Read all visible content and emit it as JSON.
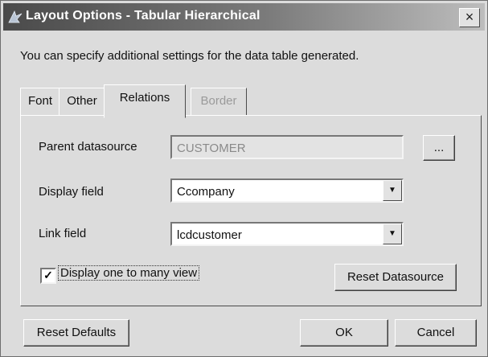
{
  "dialog": {
    "title": "Layout Options - Tabular Hierarchical",
    "close_glyph": "×",
    "description": "You can specify additional settings for the data table generated."
  },
  "tabs": [
    {
      "label": "Font",
      "active": false,
      "disabled": false
    },
    {
      "label": "Other",
      "active": false,
      "disabled": false
    },
    {
      "label": "Relations",
      "active": true,
      "disabled": false
    },
    {
      "label": "Border",
      "active": false,
      "disabled": true
    }
  ],
  "relations": {
    "parent_datasource": {
      "label": "Parent datasource",
      "value": "CUSTOMER",
      "browse_label": "..."
    },
    "display_field": {
      "label": "Display field",
      "value": "Ccompany"
    },
    "link_field": {
      "label": "Link field",
      "value": "lcdcustomer"
    },
    "one_to_many": {
      "label": "Display one to many view",
      "checked": true,
      "check_glyph": "✓"
    },
    "reset_datasource_label": "Reset Datasource"
  },
  "footer": {
    "reset_defaults_label": "Reset Defaults",
    "ok_label": "OK",
    "cancel_label": "Cancel"
  },
  "icons": {
    "title_logo": "app-logo-icon",
    "dropdown": "chevron-down-icon",
    "checkbox": "check-icon",
    "close": "close-icon"
  }
}
